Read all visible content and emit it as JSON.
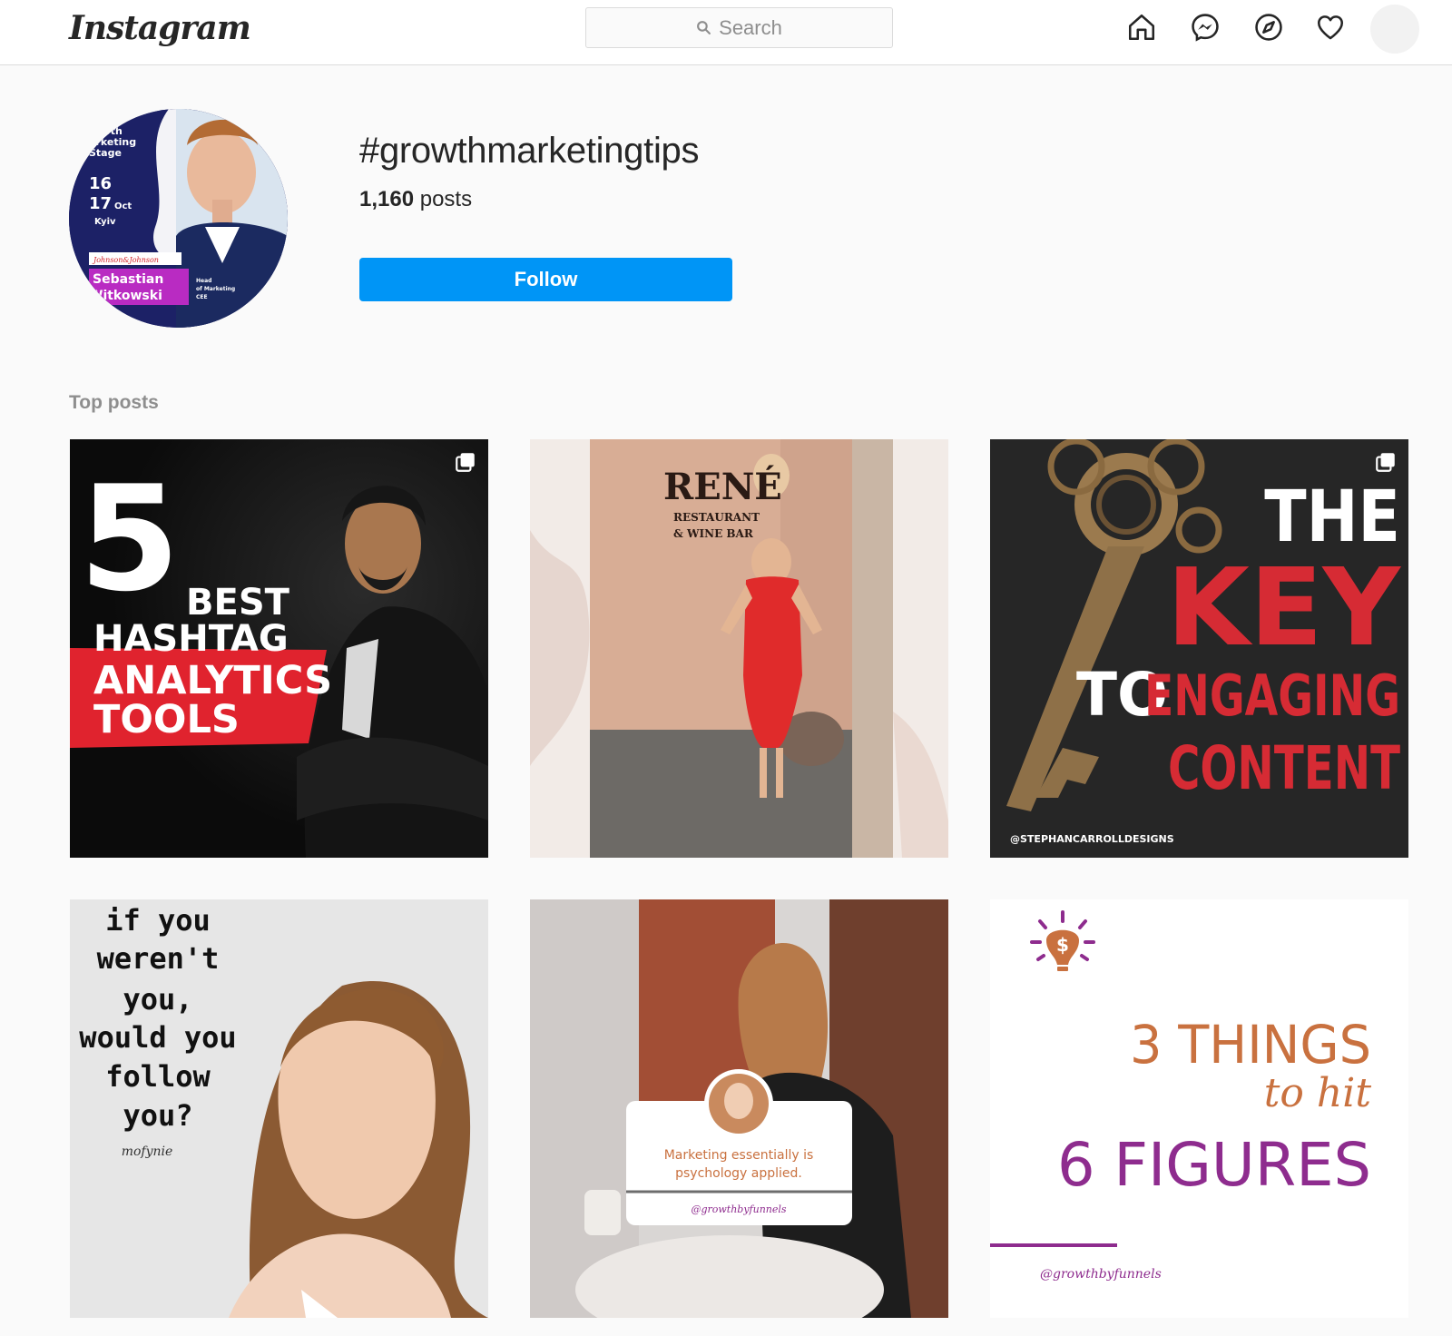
{
  "app": {
    "logo_text": "Instagram"
  },
  "search": {
    "placeholder": "Search"
  },
  "nav": {
    "icons": [
      "home-icon",
      "messenger-icon",
      "explore-icon",
      "activity-heart-icon",
      "profile-avatar"
    ]
  },
  "header": {
    "hashtag": "#growthmarketingtips",
    "posts_count": "1,160",
    "posts_label": "posts",
    "follow_label": "Follow",
    "profile_pic": {
      "lines": [
        "owth",
        "arketing",
        "Stage",
        "16",
        "17",
        "Oct",
        "Kyiv",
        "Johnson&Johnson",
        "Sebastian",
        "Witkowski",
        "Head",
        "of Marketing",
        "CEE"
      ]
    }
  },
  "section": {
    "label": "Top posts"
  },
  "posts": [
    {
      "kind": "carousel",
      "lines": [
        "5",
        "BEST",
        "HASHTAG",
        "ANALYTICS",
        "TOOLS"
      ]
    },
    {
      "kind": "photo",
      "lines": [
        "RENÉ",
        "RESTAURANT",
        "& WINE BAR"
      ]
    },
    {
      "kind": "carousel",
      "lines": [
        "THE",
        "KEY",
        "TO",
        "ENGAGING",
        "CONTENT",
        "@STEPHANCARROLLDESIGNS"
      ]
    },
    {
      "kind": "photo",
      "lines": [
        "if you",
        "weren't",
        "you,",
        "would you",
        "follow",
        "you?",
        "mofynie"
      ]
    },
    {
      "kind": "photo",
      "lines": [
        "Marketing essentially is",
        "psychology applied.",
        "@growthbyfunnels"
      ]
    },
    {
      "kind": "photo",
      "lines": [
        "3 THINGS",
        "to hit",
        "6 FIGURES",
        "@growthbyfunnels"
      ]
    }
  ],
  "colors": {
    "follow_blue": "#0095f6",
    "page_bg": "#fafafa",
    "red_banner": "#e0232e",
    "key_red": "#d62b34",
    "figures_orange": "#c9713f",
    "figures_purple": "#8e2c8e"
  }
}
